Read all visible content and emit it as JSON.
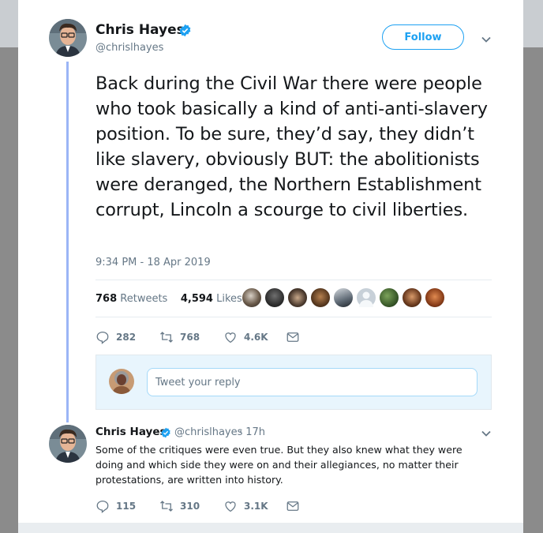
{
  "tweet": {
    "author": {
      "name": "Chris Hayes",
      "handle": "@chrislhayes"
    },
    "follow_label": "Follow",
    "text": "Back during the Civil War there were people who took basically a kind of anti-anti-slavery position. To be sure, they’d say, they didn’t like slavery, obviously BUT: the abolitionists were deranged, the Northern Establishment corrupt, Lincoln a scourge to civil liberties.",
    "timestamp": "9:34 PM - 18 Apr 2019",
    "retweets_count": "768",
    "retweets_label": "Retweets",
    "likes_count": "4,594",
    "likes_label": "Likes",
    "actions": {
      "replies": "282",
      "retweets": "768",
      "likes": "4.6K"
    }
  },
  "reply_composer": {
    "placeholder": "Tweet your reply"
  },
  "reply": {
    "author": {
      "name": "Chris Hayes",
      "handle": "@chrislhayes",
      "time": "· 17h"
    },
    "text": "Some of the critiques were even true. But they also knew what they were doing and which side they were on and their allegiances, no matter their protestations, are written into history.",
    "actions": {
      "replies": "115",
      "retweets": "310",
      "likes": "3.1K"
    }
  },
  "colors": {
    "accent": "#1da1f2",
    "thread_line": "#9bb5f6",
    "secondary_text": "#657786",
    "reply_bg": "#e8f5fd"
  },
  "icons": [
    "verified-icon",
    "chevron-down-icon",
    "reply-icon",
    "retweet-icon",
    "like-icon",
    "dm-icon"
  ]
}
